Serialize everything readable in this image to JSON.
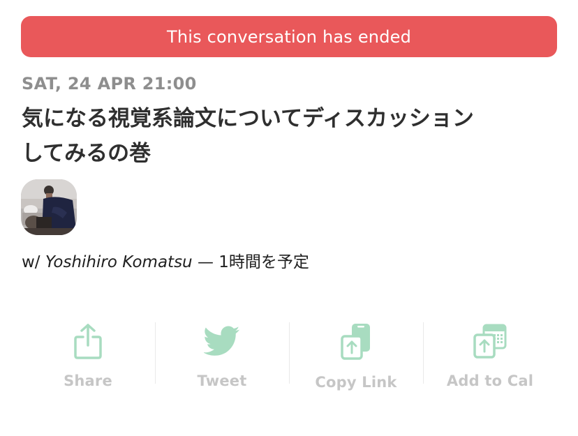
{
  "banner": {
    "text": "This conversation has ended",
    "color": "#e9585a"
  },
  "event": {
    "date": "SAT, 24 APR 21:00",
    "title": "気になる視覚系論文についてディスカッションしてみるの巻"
  },
  "host": {
    "prefix": "w/ ",
    "name": "Yoshihiro Komatsu",
    "suffix": " — 1時間を予定"
  },
  "actions": [
    {
      "label": "Share",
      "icon": "share-icon"
    },
    {
      "label": "Tweet",
      "icon": "twitter-bird-icon"
    },
    {
      "label": "Copy Link",
      "icon": "copy-link-icon"
    },
    {
      "label": "Add to Cal",
      "icon": "calendar-add-icon"
    }
  ],
  "colors": {
    "icon_green": "#a8dcc0",
    "label_gray": "#c6c6c6",
    "date_gray": "#8e8e8e",
    "title_dark": "#2f2f2f"
  }
}
